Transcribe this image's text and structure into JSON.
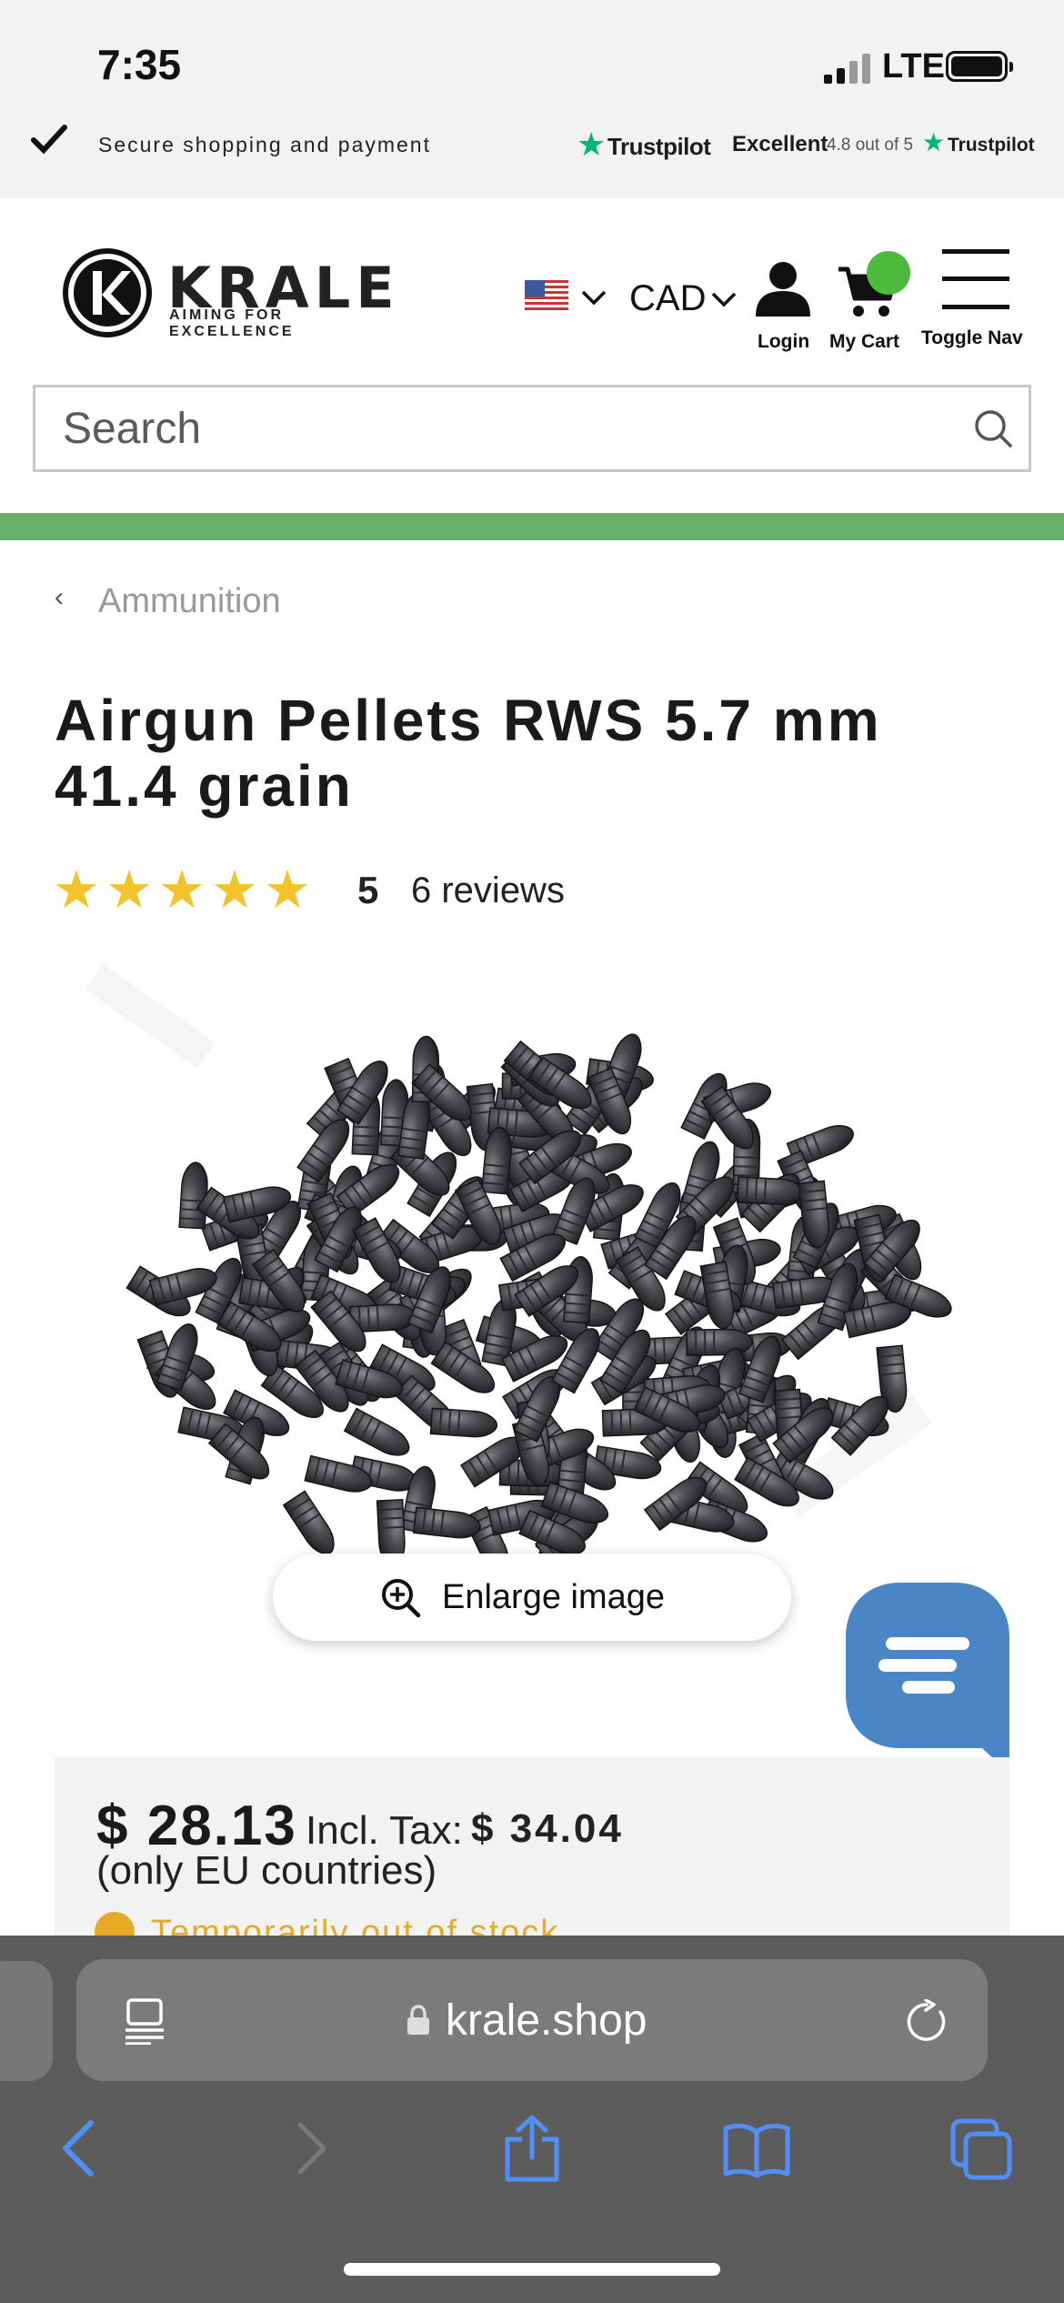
{
  "status_bar": {
    "time": "7:35",
    "network": "LTE"
  },
  "trust_bar": {
    "secure_text": "Secure shopping and payment",
    "trustpilot_brand": "Trustpilot",
    "rating_word": "Excellent",
    "rating_score": "4.8 out of 5",
    "trustpilot_brand_small": "Trustpilot",
    "star_color": "#00b67a"
  },
  "header": {
    "logo_word": "KRALE",
    "logo_tagline": "AIMING FOR EXCELLENCE",
    "country_flag": "us-flag-icon",
    "currency": "CAD",
    "login_label": "Login",
    "cart_label": "My Cart",
    "nav_label": "Toggle Nav",
    "cart_badge_color": "#4cbb3d"
  },
  "search": {
    "placeholder": "Search"
  },
  "accent_band_color": "#6aaf6c",
  "product": {
    "breadcrumb_back": "‹",
    "breadcrumb": "Ammunition",
    "title": "Airgun Pellets RWS 5.7 mm 41.4 grain",
    "stars": "★★★★★",
    "rating": "5",
    "reviews": "6  reviews",
    "enlarge_label": "Enlarge image",
    "price": "$ 28.13",
    "incl_tax_label": "Incl. Tax:",
    "incl_tax_value": "$ 34.04",
    "eu_note": "(only EU countries)",
    "stock_status": "Temporarily out of stock",
    "stock_color": "#e6aa26"
  },
  "chat_widget": {
    "color": "#4a86c5"
  },
  "browser": {
    "url": "krale.shop"
  }
}
